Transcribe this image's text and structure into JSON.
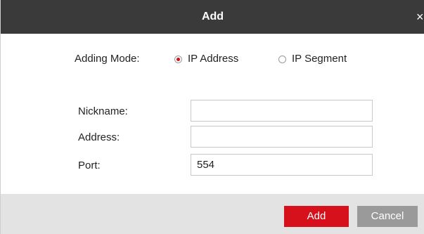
{
  "dialog": {
    "title": "Add",
    "close_glyph": "×"
  },
  "adding_mode": {
    "label": "Adding Mode:",
    "options": [
      {
        "label": "IP Address",
        "selected": true
      },
      {
        "label": "IP Segment",
        "selected": false
      }
    ]
  },
  "fields": {
    "nickname": {
      "label": "Nickname:",
      "value": ""
    },
    "address": {
      "label": "Address:",
      "value": ""
    },
    "port": {
      "label": "Port:",
      "value": "554"
    }
  },
  "buttons": {
    "add_label": "Add",
    "cancel_label": "Cancel"
  },
  "colors": {
    "accent": "#d7111c",
    "titlebar": "#3a3a3a",
    "footer": "#e3e3e3",
    "cancel": "#9a9a9a"
  },
  "icons": {
    "close": "close-icon",
    "radio": "radio-icon"
  }
}
